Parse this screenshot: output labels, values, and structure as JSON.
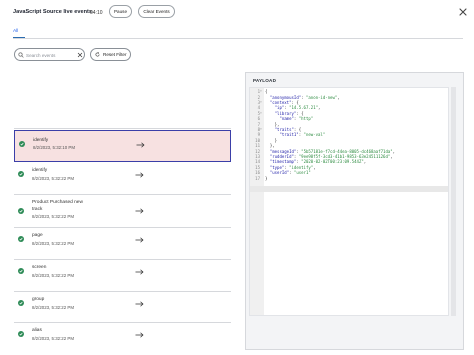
{
  "header": {
    "title": "JavaScript Source live events",
    "timer": "04:10",
    "pause_label": "Pause",
    "clear_label": "Clear Events"
  },
  "tabs": [
    {
      "label": "All"
    }
  ],
  "search": {
    "placeholder": "Search events",
    "reset_label": "Reset Filter"
  },
  "events": [
    {
      "name": "identify",
      "date": "8/2/2023, 5:32:10 PM",
      "selected": true
    },
    {
      "name": "identify",
      "date": "8/2/2023, 5:32:22 PM",
      "selected": false
    },
    {
      "name": "Product Purchased new track",
      "name_line1": "Product Purchased new",
      "name_line2": "track",
      "date": "8/2/2023, 5:32:22 PM",
      "selected": false
    },
    {
      "name": "page",
      "date": "8/2/2023, 5:32:22 PM",
      "selected": false
    },
    {
      "name": "screen",
      "date": "8/2/2023, 5:32:22 PM",
      "selected": false
    },
    {
      "name": "group",
      "date": "8/2/2023, 5:32:22 PM",
      "selected": false
    },
    {
      "name": "alias",
      "date": "8/2/2023, 5:32:22 PM",
      "selected": false
    }
  ],
  "payload": {
    "label": "PAYLOAD",
    "lines": [
      {
        "n": "1",
        "fold": true,
        "text": "{"
      },
      {
        "n": "2",
        "fold": false,
        "text": "  \"anonymousId\": \"anon-id-new\","
      },
      {
        "n": "3",
        "fold": true,
        "text": "  \"context\": {"
      },
      {
        "n": "4",
        "fold": false,
        "text": "    \"ip\": \"14.5.67.21\","
      },
      {
        "n": "5",
        "fold": true,
        "text": "    \"library\": {"
      },
      {
        "n": "6",
        "fold": false,
        "text": "      \"name\": \"http\""
      },
      {
        "n": "7",
        "fold": false,
        "text": "    },"
      },
      {
        "n": "8",
        "fold": true,
        "text": "    \"traits\": {"
      },
      {
        "n": "9",
        "fold": false,
        "text": "      \"trait1\": \"new-val\""
      },
      {
        "n": "10",
        "fold": false,
        "text": "    }"
      },
      {
        "n": "11",
        "fold": false,
        "text": "  },"
      },
      {
        "n": "12",
        "fold": false,
        "text": "  \"messageId\": \"5b57181e-f7cd-44ea-8005-dc468aaf71da\","
      },
      {
        "n": "13",
        "fold": false,
        "text": "  \"rudderId\": \"9ee98f5f-3cd3-41b1-9853-63e24511126d\","
      },
      {
        "n": "14",
        "fold": false,
        "text": "  \"timestamp\": \"2020-02-02T00:23:09.544Z\","
      },
      {
        "n": "15",
        "fold": false,
        "text": "  \"type\": \"identify\","
      },
      {
        "n": "16",
        "fold": false,
        "text": "  \"userId\": \"user1\""
      },
      {
        "n": "17",
        "fold": false,
        "text": "}"
      }
    ]
  },
  "colors": {
    "accent": "#2563eb",
    "success": "#2e8b57",
    "selected_bg": "#f7e1e1",
    "selected_border": "#3b3fa8"
  },
  "icons": {
    "close": "close-icon",
    "search": "search-icon",
    "clear_search": "clear-icon",
    "reset": "refresh-icon",
    "check": "check-circle-icon",
    "arrow": "arrow-right-icon"
  }
}
